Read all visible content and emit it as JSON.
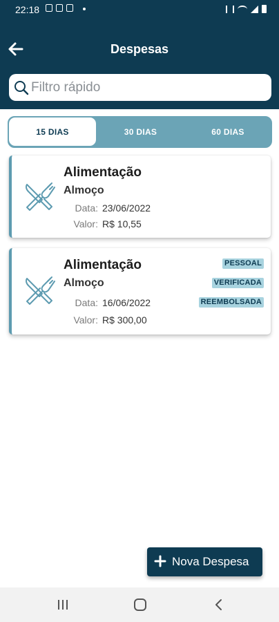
{
  "status_bar": {
    "time": "22:18"
  },
  "header": {
    "title": "Despesas"
  },
  "search": {
    "placeholder": "Filtro rápido"
  },
  "tabs": [
    {
      "label": "15 DIAS",
      "selected": true
    },
    {
      "label": "30 DIAS",
      "selected": false
    },
    {
      "label": "60 DIAS",
      "selected": false
    }
  ],
  "expenses": [
    {
      "category": "Alimentação",
      "subcategory": "Almoço",
      "date_label": "Data:",
      "date": "23/06/2022",
      "value_label": "Valor:",
      "value": "R$ 10,55",
      "icon": "fork-knife-icon",
      "badges": []
    },
    {
      "category": "Alimentação",
      "subcategory": "Almoço",
      "date_label": "Data:",
      "date": "16/06/2022",
      "value_label": "Valor:",
      "value": "R$ 300,00",
      "icon": "fork-knife-icon",
      "badges": [
        "PESSOAL",
        "VERIFICADA",
        "REEMBOLSADA"
      ]
    }
  ],
  "fab": {
    "label": "Nova Despesa",
    "icon": "plus-icon"
  },
  "colors": {
    "primary": "#0e3b52",
    "accent": "#6ba4b6",
    "badge": "#a8d3df",
    "card_border": "#5d9bb0"
  }
}
